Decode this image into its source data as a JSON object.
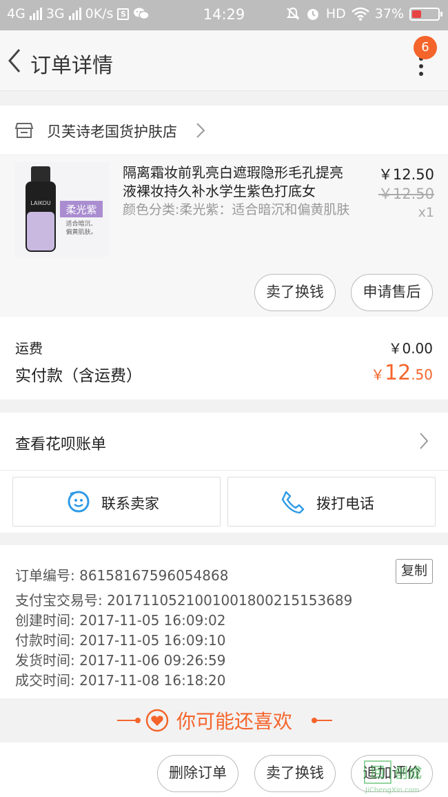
{
  "status_bar": {
    "left_text": "4G",
    "network2": "3G",
    "speed": "0K/s",
    "time": "14:29",
    "hd": "HD",
    "battery": "37%",
    "battery_fill": 0.37
  },
  "navbar": {
    "title": "订单详情",
    "badge": "6"
  },
  "shop": {
    "name": "贝芙诗老国货护肤店"
  },
  "product": {
    "title": "隔离霜妆前乳亮白遮瑕隐形毛孔提亮液裸妆持久补水学生紫色打底女",
    "sku": "颜色分类:柔光紫：适合暗沉和偏黄肌肤",
    "price": "￥12.50",
    "original_price": "￥12.50",
    "quantity": "x1",
    "image_brand": "LAIKOU",
    "image_tag": "柔光紫",
    "image_note1": "适合暗沉、",
    "image_note2": "偏黄肌肤。"
  },
  "item_actions": {
    "sell_label": "卖了换钱",
    "after_sale_label": "申请售后"
  },
  "fees": {
    "shipping_label": "运费",
    "shipping_value": "￥0.00",
    "paid_label": "实付款（含运费）",
    "paid_currency": "￥",
    "paid_integer": "12",
    "paid_decimal": ".50"
  },
  "huabei": {
    "label": "查看花呗账单"
  },
  "contact": {
    "seller_label": "联系卖家",
    "call_label": "拨打电话"
  },
  "order_info": {
    "order_no": "订单编号: 86158167596054868",
    "alipay_no": "支付宝交易号: 2017110521001001800215153689",
    "created": "创建时间: 2017-11-05 16:09:02",
    "paid": "付款时间: 2017-11-05 16:09:10",
    "shipped": "发货时间: 2017-11-06 09:26:59",
    "completed": "成交时间: 2017-11-08 16:18:20",
    "copy_label": "复制"
  },
  "recommend": {
    "title": "你可能还喜欢"
  },
  "bottom_bar": {
    "delete_label": "删除订单",
    "sell_label": "卖了换钱",
    "review_label": "追加评价"
  },
  "watermark": {
    "mark": "回",
    "text": "创成",
    "url": "JiChengXin.com"
  },
  "colors": {
    "accent": "#f5642b",
    "status_bar": "#bdbdbd",
    "link_blue": "#2f9be6"
  }
}
